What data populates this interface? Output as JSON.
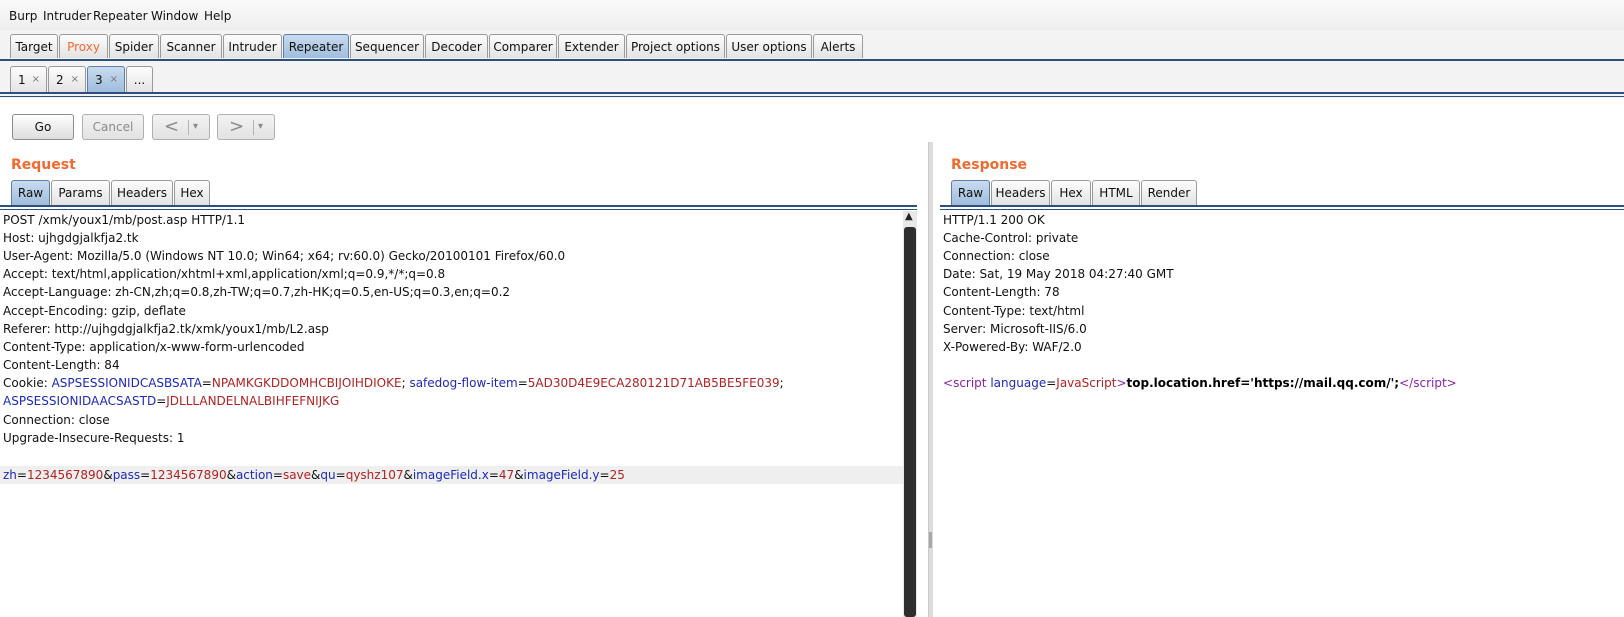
{
  "menu": [
    "Burp",
    "Intruder",
    "Repeater",
    "Window",
    "Help"
  ],
  "main_tabs": [
    "Target",
    "Proxy",
    "Spider",
    "Scanner",
    "Intruder",
    "Repeater",
    "Sequencer",
    "Decoder",
    "Comparer",
    "Extender",
    "Project options",
    "User options",
    "Alerts"
  ],
  "active_main_tab": "Repeater",
  "repeater_tabs": [
    "1",
    "2",
    "3",
    "..."
  ],
  "close_glyph": "×",
  "toolbar": {
    "go": "Go",
    "cancel": "Cancel",
    "back": "<",
    "forward": ">",
    "dropdown": "▾"
  },
  "request": {
    "title": "Request",
    "tabs": [
      "Raw",
      "Params",
      "Headers",
      "Hex"
    ],
    "lines": [
      "POST /xmk/youx1/mb/post.asp HTTP/1.1",
      "Host: ujhgdgjalkfja2.tk",
      "User-Agent: Mozilla/5.0 (Windows NT 10.0; Win64; x64; rv:60.0) Gecko/20100101 Firefox/60.0",
      "Accept: text/html,application/xhtml+xml,application/xml;q=0.9,*/*;q=0.8",
      "Accept-Language: zh-CN,zh;q=0.8,zh-TW;q=0.7,zh-HK;q=0.5,en-US;q=0.3,en;q=0.2",
      "Accept-Encoding: gzip, deflate",
      "Referer: http://ujhgdgjalkfja2.tk/xmk/youx1/mb/L2.asp",
      "Content-Type: application/x-www-form-urlencoded",
      "Content-Length: 84"
    ],
    "cookie_label": "Cookie: ",
    "cookie1_name": "ASPSESSIONIDCASBSATA",
    "cookie1_value": "NPAMKGKDDOMHCBIJOIHDIOKE",
    "cookie2_name": "safedog-flow-item",
    "cookie2_value": "5AD30D4E9ECA280121D71AB5BE5FE039",
    "cookie3_name": "ASPSESSIONIDAACSASTD",
    "cookie3_value": "JDLLLANDELNALBIHFEFNIJKG",
    "lines_after": [
      "Connection: close",
      "Upgrade-Insecure-Requests: 1"
    ],
    "body_params": [
      {
        "name": "zh",
        "value": "1234567890"
      },
      {
        "name": "pass",
        "value": "1234567890"
      },
      {
        "name": "action",
        "value": "save"
      },
      {
        "name": "qu",
        "value": "qyshz107"
      },
      {
        "name": "imageField.x",
        "value": "47"
      },
      {
        "name": "imageField.y",
        "value": "25"
      }
    ]
  },
  "response": {
    "title": "Response",
    "tabs": [
      "Raw",
      "Headers",
      "Hex",
      "HTML",
      "Render"
    ],
    "lines": [
      "HTTP/1.1 200 OK",
      "Cache-Control: private",
      "Connection: close",
      "Date: Sat, 19 May 2018 04:27:40 GMT",
      "Content-Length: 78",
      "Content-Type: text/html",
      "Server: Microsoft-IIS/6.0",
      "X-Powered-By: WAF/2.0"
    ],
    "script_open": "<",
    "script_tag": "script",
    "script_attr": "language",
    "script_attr_value": "JavaScript",
    "script_body": "top.location.href='https://mail.qq.com/';",
    "script_close_open": "</",
    "script_close_end": ">"
  },
  "colors": {
    "accent": "#f06a30",
    "tab_active": "#9fbddd",
    "param_name": "#1c2ab8",
    "param_value": "#b22222",
    "html_tag": "#8a1fb0"
  }
}
